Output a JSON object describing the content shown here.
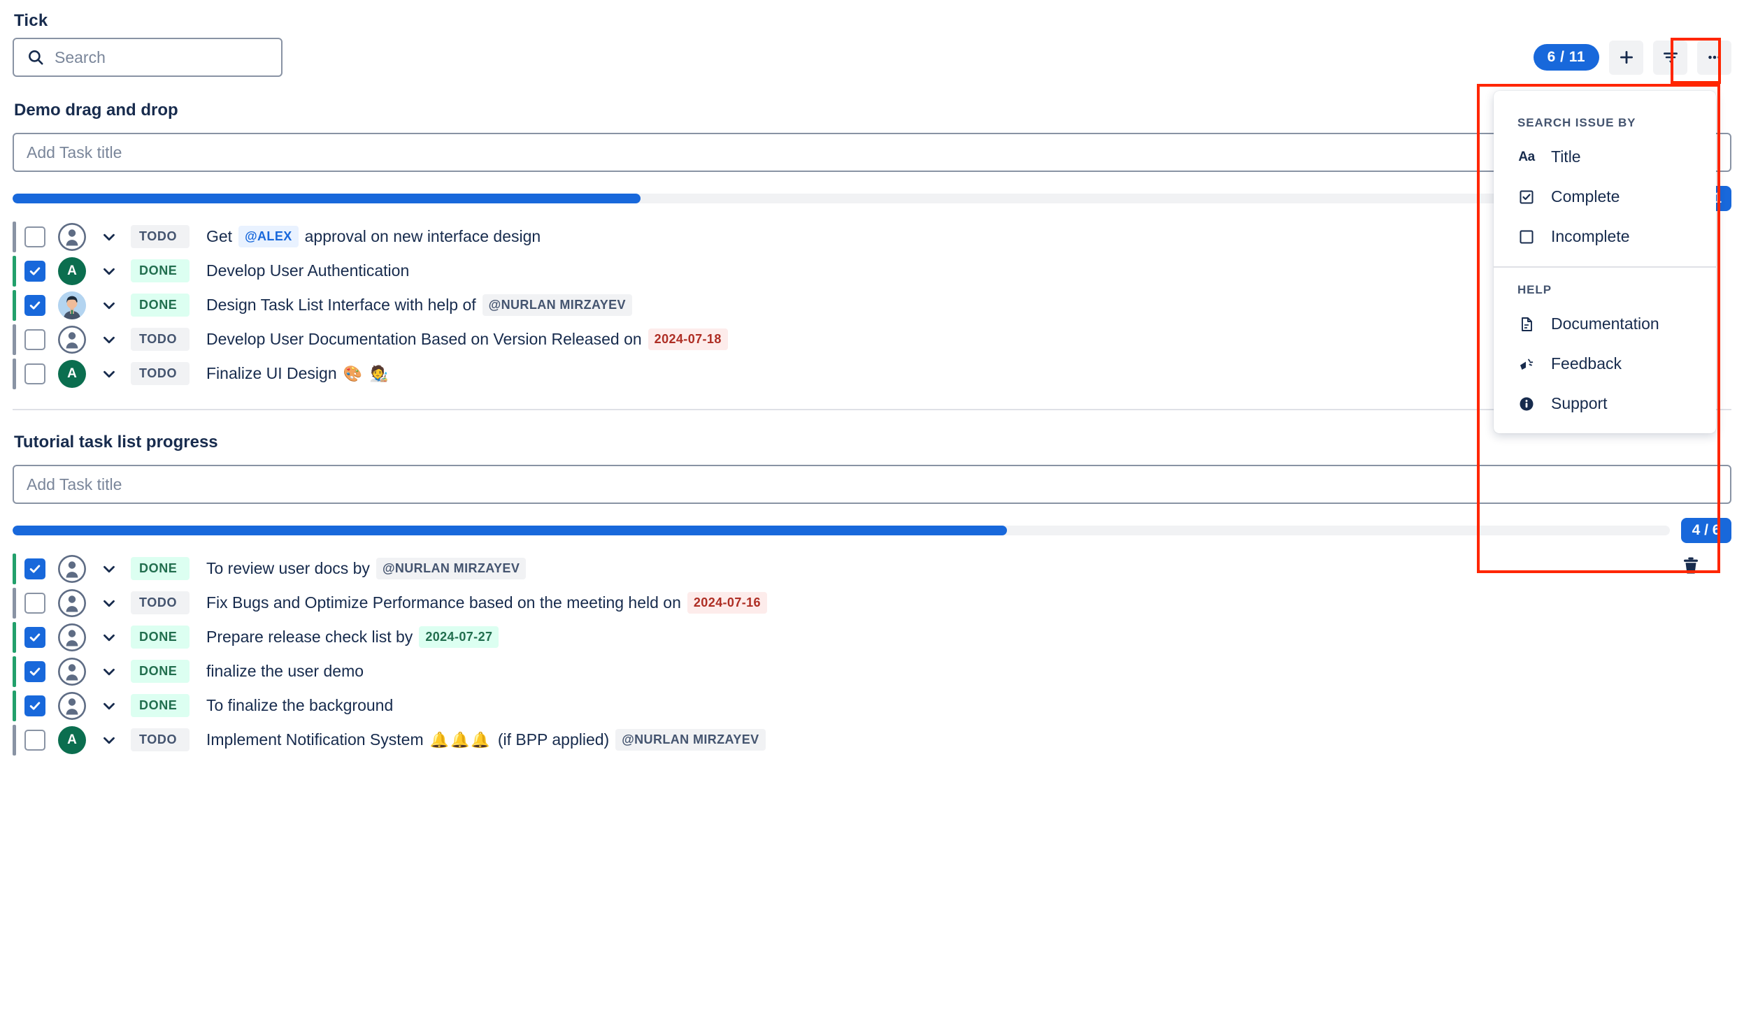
{
  "app": {
    "title": "Tick"
  },
  "search": {
    "placeholder": "Search",
    "icon": "search-icon"
  },
  "toolbar": {
    "count_badge": "6 / 11",
    "add_label": "+",
    "filter_icon": "filter-icon",
    "more_icon": "more-horizontal-icon",
    "accent_color": "#1868db"
  },
  "menu": {
    "group1_label": "SEARCH ISSUE BY",
    "items1": [
      {
        "label": "Title",
        "icon": "text-format-icon"
      },
      {
        "label": "Complete",
        "icon": "checkbox-checked-icon"
      },
      {
        "label": "Incomplete",
        "icon": "checkbox-empty-icon"
      }
    ],
    "group2_label": "HELP",
    "items2": [
      {
        "label": "Documentation",
        "icon": "document-icon"
      },
      {
        "label": "Feedback",
        "icon": "megaphone-icon"
      },
      {
        "label": "Support",
        "icon": "info-icon"
      }
    ]
  },
  "sections": [
    {
      "title": "Demo drag and drop",
      "add_placeholder": "Add Task title",
      "progress_percent": 38,
      "progress_badge": "6 / 11",
      "tasks": [
        {
          "checked": false,
          "status": "TODO",
          "avatar": "grey",
          "parts": [
            {
              "t": "text",
              "v": "Get"
            },
            {
              "t": "mention-blue",
              "v": "@ALEX"
            },
            {
              "t": "text",
              "v": "approval on new interface design"
            }
          ]
        },
        {
          "checked": true,
          "status": "DONE",
          "avatar": "green",
          "avatar_letter": "A",
          "parts": [
            {
              "t": "text",
              "v": "Develop User Authentication"
            }
          ]
        },
        {
          "checked": true,
          "status": "DONE",
          "avatar": "photo",
          "parts": [
            {
              "t": "text",
              "v": "Design Task List Interface with help of"
            },
            {
              "t": "mention-grey",
              "v": "@NURLAN MIRZAYEV"
            }
          ]
        },
        {
          "checked": false,
          "status": "TODO",
          "avatar": "grey",
          "parts": [
            {
              "t": "text",
              "v": "Develop User Documentation Based on Version Released on"
            },
            {
              "t": "date-red",
              "v": "2024-07-18"
            }
          ]
        },
        {
          "checked": false,
          "status": "TODO",
          "avatar": "green",
          "avatar_letter": "A",
          "parts": [
            {
              "t": "text",
              "v": "Finalize UI Design"
            },
            {
              "t": "emoji",
              "v": "🎨 🧑‍🎨"
            }
          ]
        }
      ]
    },
    {
      "title": "Tutorial task list progress",
      "add_placeholder": "Add Task title",
      "progress_percent": 60,
      "progress_badge": "4 / 6",
      "tasks": [
        {
          "checked": true,
          "status": "DONE",
          "avatar": "grey",
          "parts": [
            {
              "t": "text",
              "v": "To review user docs by"
            },
            {
              "t": "mention-grey",
              "v": "@NURLAN MIRZAYEV"
            }
          ]
        },
        {
          "checked": false,
          "status": "TODO",
          "avatar": "grey",
          "parts": [
            {
              "t": "text",
              "v": "Fix Bugs and Optimize Performance based on the meeting held on"
            },
            {
              "t": "date-red",
              "v": "2024-07-16"
            }
          ]
        },
        {
          "checked": true,
          "status": "DONE",
          "avatar": "grey",
          "parts": [
            {
              "t": "text",
              "v": "Prepare release check list by"
            },
            {
              "t": "date-green",
              "v": "2024-07-27"
            }
          ]
        },
        {
          "checked": true,
          "status": "DONE",
          "avatar": "grey",
          "parts": [
            {
              "t": "text",
              "v": "finalize the user demo"
            }
          ]
        },
        {
          "checked": true,
          "status": "DONE",
          "avatar": "grey",
          "parts": [
            {
              "t": "text",
              "v": "To finalize the background"
            }
          ]
        },
        {
          "checked": false,
          "status": "TODO",
          "avatar": "green",
          "avatar_letter": "A",
          "parts": [
            {
              "t": "text",
              "v": "Implement Notification System"
            },
            {
              "t": "emoji",
              "v": "🔔🔔🔔"
            },
            {
              "t": "text",
              "v": "(if BPP applied)"
            },
            {
              "t": "mention-grey",
              "v": "@NURLAN MIRZAYEV"
            }
          ]
        }
      ]
    }
  ],
  "annotations": {
    "color": "#ff2600"
  },
  "trash": {
    "icon": "trash-icon"
  }
}
